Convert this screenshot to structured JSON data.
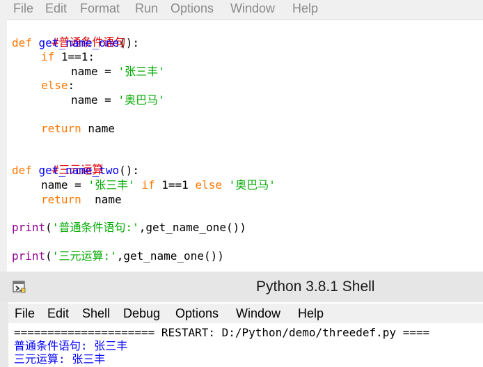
{
  "editor": {
    "menu": [
      "File",
      "Edit",
      "Format",
      "Run",
      "Options",
      "Window",
      "Help"
    ],
    "code": {
      "comment1": "#普通条件语句",
      "def_kw_1": "def",
      "func_name_1": "get_name_one",
      "def_tail_1": "():",
      "if_kw": "if",
      "if_cond": " 1==1:",
      "name_assign_1": "name = ",
      "str_zhang_1": "'张三丰'",
      "else_kw": "else",
      "else_colon": ":",
      "name_assign_2": "name = ",
      "str_obama_1": "'奥巴马'",
      "return_kw_1": "return",
      "return_val_1": " name",
      "comment2": "#三元运算",
      "def_kw_2": "def",
      "func_name_2": "get_name_two",
      "def_tail_2": "():",
      "name_assign_3": "name = ",
      "str_zhang_2": "'张三丰'",
      "if_kw_2": "if",
      "cond_2": " 1==1 ",
      "else_kw_2": "else",
      "str_obama_2": "'奥巴马'",
      "return_kw_2": "return",
      "return_val_2": "  name",
      "print_kw_1": "print",
      "print_open_1": "(",
      "print_str_1": "'普通条件语句:'",
      "print_rest_1": ",get_name_one())",
      "print_kw_2": "print",
      "print_open_2": "(",
      "print_str_2": "'三元运算:'",
      "print_rest_2": ",get_name_one())"
    }
  },
  "shell": {
    "title": "Python 3.8.1 Shell",
    "menu": [
      "File",
      "Edit",
      "Shell",
      "Debug",
      "Options",
      "Window",
      "Help"
    ],
    "restart_line": "===================== RESTART: D:/Python/demo/threedef.py ====",
    "output_1": "普通条件语句: 张三丰",
    "output_2": "三元运算: 张三丰"
  },
  "colors": {
    "comment": "#dd0000",
    "keyword": "#ff7700",
    "def_name": "#0000ff",
    "builtin": "#900090",
    "string": "#00aa00",
    "stdout": "#0000ff"
  }
}
